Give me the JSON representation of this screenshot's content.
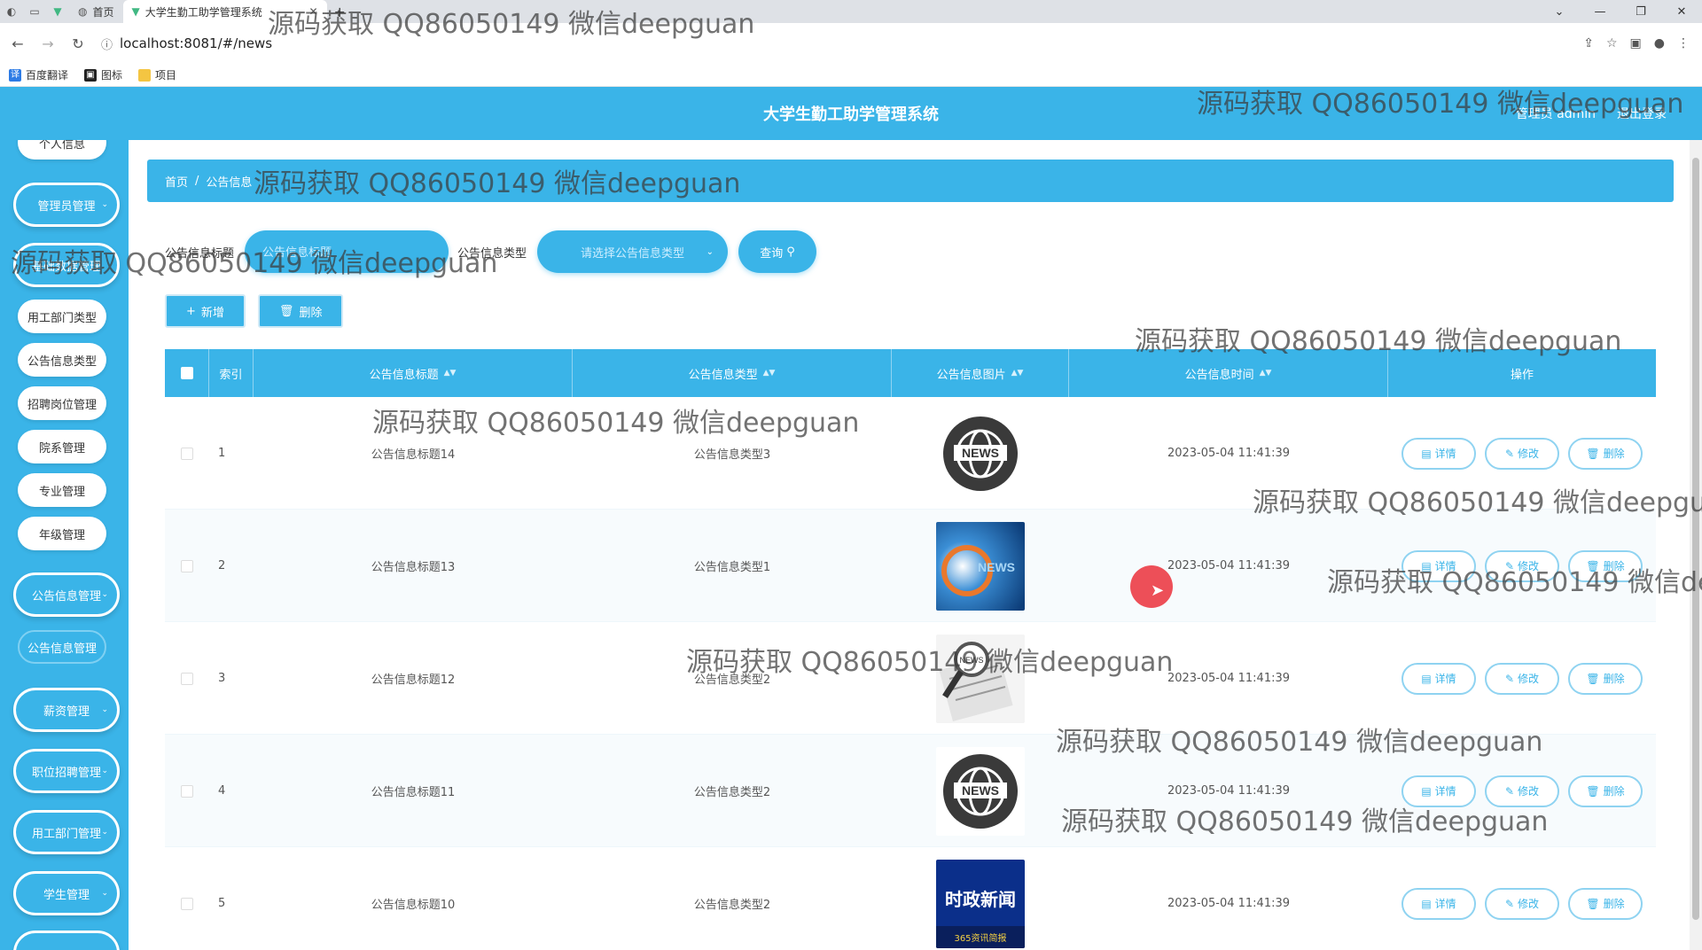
{
  "browser": {
    "tabs": [
      {
        "label": "首页"
      },
      {
        "label": "大学生勤工助学管理系统"
      }
    ],
    "url": "localhost:8081/#/news",
    "bookmarks": [
      "百度翻译",
      "图标",
      "项目"
    ]
  },
  "header": {
    "title": "大学生勤工助学管理系统",
    "user": "管理员 admin",
    "logout": "退出登录"
  },
  "sidebar": {
    "top_item": "个人信息",
    "group_admin": "管理员管理",
    "group_hidden": "基础数据管理",
    "sub_items": [
      "用工部门类型",
      "公告信息类型",
      "招聘岗位管理",
      "院系管理",
      "专业管理",
      "年级管理"
    ],
    "group_news": "公告信息管理",
    "news_sub": "公告信息管理",
    "group_salary": "薪资管理",
    "group_jobs": "职位招聘管理",
    "group_dept": "用工部门管理",
    "group_student": "学生管理"
  },
  "breadcrumb": {
    "home": "首页",
    "sep": "/",
    "current": "公告信息"
  },
  "search": {
    "title_label": "公告信息标题",
    "title_placeholder": "公告信息标题",
    "type_label": "公告信息类型",
    "type_placeholder": "请选择公告信息类型",
    "query_button": "查询"
  },
  "actions": {
    "add": "新增",
    "delete": "删除"
  },
  "table": {
    "columns": {
      "index": "索引",
      "title": "公告信息标题",
      "type": "公告信息类型",
      "image": "公告信息图片",
      "time": "公告信息时间",
      "ops": "操作"
    },
    "op_labels": {
      "detail": "详情",
      "edit": "修改",
      "delete": "删除"
    },
    "rows": [
      {
        "index": "1",
        "title": "公告信息标题14",
        "type": "公告信息类型3",
        "image": "news-globe",
        "time": "2023-05-04 11:41:39"
      },
      {
        "index": "2",
        "title": "公告信息标题13",
        "type": "公告信息类型1",
        "image": "news-blue",
        "time": "2023-05-04 11:41:39"
      },
      {
        "index": "3",
        "title": "公告信息标题12",
        "type": "公告信息类型2",
        "image": "news-magnifier",
        "time": "2023-05-04 11:41:39"
      },
      {
        "index": "4",
        "title": "公告信息标题11",
        "type": "公告信息类型2",
        "image": "news-globe",
        "time": "2023-05-04 11:41:39"
      },
      {
        "index": "5",
        "title": "公告信息标题10",
        "type": "公告信息类型2",
        "image": "news-politics",
        "time": "2023-05-04 11:41:39"
      }
    ],
    "thumb_texts": {
      "news": "NEWS",
      "politics_main": "时政新闻",
      "politics_sub": "365资讯简报"
    }
  },
  "watermark_text": "源码获取 QQ86050149 微信deepguan",
  "colors": {
    "primary": "#3ab4e8",
    "cursor": "#eb3c46"
  }
}
